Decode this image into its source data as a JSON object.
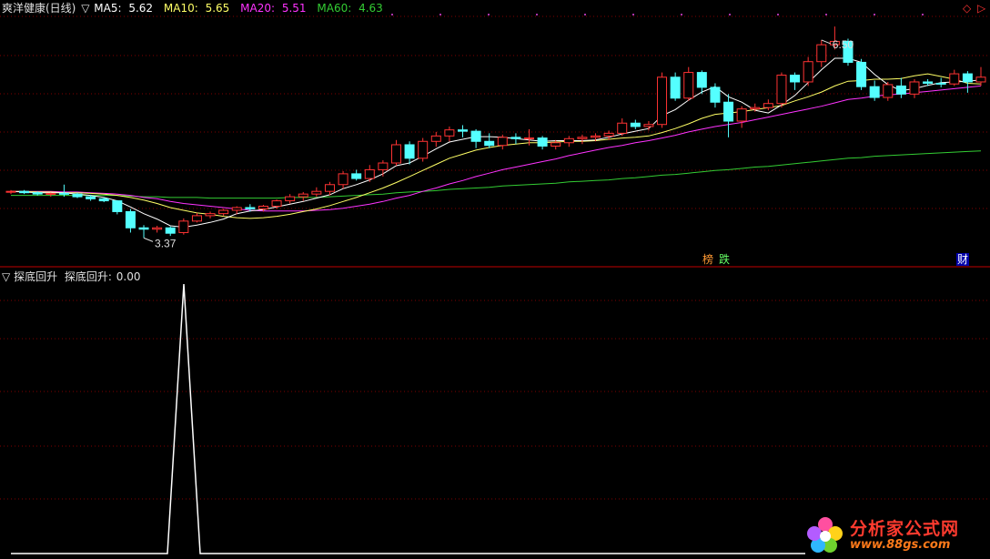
{
  "header": {
    "stock_title": "爽洋健康(日线)",
    "collapse_glyph": "▽",
    "ma5_label": "MA5:",
    "ma5_value": "5.62",
    "ma10_label": "MA10:",
    "ma10_value": "5.65",
    "ma20_label": "MA20:",
    "ma20_value": "5.51",
    "ma60_label": "MA60:",
    "ma60_value": "4.63"
  },
  "indicator": {
    "collapse_glyph": "▽",
    "name": "探底回升",
    "series_label": "探底回升:",
    "series_value": "0.00"
  },
  "markers": {
    "high_label": "6.50",
    "low_label": "3.37",
    "tag_bang": "榜",
    "tag_die": "跌",
    "tag_cai": "财"
  },
  "colors": {
    "bg": "#000000",
    "up": "#ff3333",
    "down": "#54ffff",
    "ma5": "#ffffff",
    "ma10": "#ffff66",
    "ma20": "#ff33ff",
    "ma60": "#33cc33",
    "grid": "#800000",
    "panel_border": "#c00000",
    "indicator_line": "#ffffff"
  },
  "icons": {
    "top_right_diamond": "diamond-icon",
    "top_right_arrow": "right-arrow-icon",
    "logo": "flower-logo-icon"
  },
  "logo": {
    "title": "分析家公式网",
    "url": "www.88gs.com"
  },
  "chart_data": {
    "type": "candlestick",
    "ylim": [
      3.2,
      6.65
    ],
    "candles": [
      [
        4.05,
        4.08,
        4.02,
        4.06
      ],
      [
        4.06,
        4.08,
        4.02,
        4.04
      ],
      [
        4.04,
        4.06,
        4.0,
        4.02
      ],
      [
        4.02,
        4.04,
        3.98,
        4.03
      ],
      [
        4.03,
        4.16,
        3.98,
        4.02
      ],
      [
        4.02,
        4.04,
        3.96,
        3.98
      ],
      [
        3.98,
        4.01,
        3.92,
        3.95
      ],
      [
        3.95,
        3.97,
        3.9,
        3.92
      ],
      [
        3.92,
        3.93,
        3.72,
        3.76
      ],
      [
        3.76,
        3.8,
        3.45,
        3.52
      ],
      [
        3.52,
        3.56,
        3.37,
        3.5
      ],
      [
        3.5,
        3.55,
        3.45,
        3.52
      ],
      [
        3.52,
        3.54,
        3.4,
        3.44
      ],
      [
        3.45,
        3.66,
        3.42,
        3.62
      ],
      [
        3.62,
        3.74,
        3.6,
        3.7
      ],
      [
        3.7,
        3.76,
        3.66,
        3.73
      ],
      [
        3.73,
        3.8,
        3.7,
        3.78
      ],
      [
        3.78,
        3.84,
        3.72,
        3.82
      ],
      [
        3.82,
        3.87,
        3.76,
        3.8
      ],
      [
        3.8,
        3.86,
        3.76,
        3.84
      ],
      [
        3.84,
        3.94,
        3.8,
        3.92
      ],
      [
        3.92,
        4.02,
        3.88,
        3.98
      ],
      [
        3.98,
        4.05,
        3.92,
        4.02
      ],
      [
        4.02,
        4.12,
        3.98,
        4.06
      ],
      [
        4.06,
        4.2,
        4.0,
        4.16
      ],
      [
        4.16,
        4.36,
        4.1,
        4.32
      ],
      [
        4.32,
        4.38,
        4.22,
        4.25
      ],
      [
        4.25,
        4.45,
        4.2,
        4.38
      ],
      [
        4.38,
        4.52,
        4.28,
        4.48
      ],
      [
        4.48,
        4.82,
        4.44,
        4.75
      ],
      [
        4.75,
        4.8,
        4.46,
        4.55
      ],
      [
        4.55,
        4.85,
        4.5,
        4.8
      ],
      [
        4.8,
        4.94,
        4.72,
        4.88
      ],
      [
        4.88,
        5.02,
        4.8,
        4.97
      ],
      [
        4.97,
        5.04,
        4.86,
        4.95
      ],
      [
        4.95,
        4.98,
        4.7,
        4.8
      ],
      [
        4.8,
        4.92,
        4.7,
        4.74
      ],
      [
        4.74,
        4.9,
        4.68,
        4.86
      ],
      [
        4.86,
        4.92,
        4.76,
        4.84
      ],
      [
        4.84,
        4.98,
        4.74,
        4.85
      ],
      [
        4.85,
        4.88,
        4.68,
        4.73
      ],
      [
        4.73,
        4.82,
        4.68,
        4.78
      ],
      [
        4.78,
        4.88,
        4.72,
        4.84
      ],
      [
        4.84,
        4.9,
        4.76,
        4.86
      ],
      [
        4.86,
        4.92,
        4.8,
        4.88
      ],
      [
        4.88,
        4.96,
        4.82,
        4.92
      ],
      [
        4.92,
        5.14,
        4.88,
        5.07
      ],
      [
        5.07,
        5.12,
        4.98,
        5.02
      ],
      [
        5.02,
        5.1,
        4.96,
        5.05
      ],
      [
        5.05,
        5.82,
        5.0,
        5.75
      ],
      [
        5.75,
        5.82,
        5.4,
        5.44
      ],
      [
        5.44,
        5.9,
        5.4,
        5.82
      ],
      [
        5.82,
        5.85,
        5.5,
        5.6
      ],
      [
        5.6,
        5.66,
        5.3,
        5.38
      ],
      [
        5.38,
        5.5,
        4.86,
        5.1
      ],
      [
        5.1,
        5.32,
        5.0,
        5.28
      ],
      [
        5.28,
        5.36,
        5.24,
        5.3
      ],
      [
        5.3,
        5.42,
        5.26,
        5.36
      ],
      [
        5.36,
        5.82,
        5.3,
        5.78
      ],
      [
        5.78,
        5.82,
        5.56,
        5.68
      ],
      [
        5.68,
        6.05,
        5.62,
        5.98
      ],
      [
        5.98,
        6.3,
        5.9,
        6.23
      ],
      [
        6.23,
        6.5,
        6.16,
        6.28
      ],
      [
        6.28,
        6.32,
        5.92,
        5.97
      ],
      [
        5.97,
        6.02,
        5.56,
        5.61
      ],
      [
        5.61,
        5.7,
        5.4,
        5.45
      ],
      [
        5.45,
        5.68,
        5.4,
        5.64
      ],
      [
        5.62,
        5.74,
        5.44,
        5.5
      ],
      [
        5.5,
        5.72,
        5.44,
        5.68
      ],
      [
        5.68,
        5.72,
        5.62,
        5.66
      ],
      [
        5.66,
        5.74,
        5.6,
        5.65
      ],
      [
        5.65,
        5.86,
        5.62,
        5.8
      ],
      [
        5.8,
        5.84,
        5.52,
        5.68
      ],
      [
        5.68,
        5.9,
        5.62,
        5.75
      ]
    ],
    "ma": {
      "ma5": [
        4.06,
        4.05,
        4.04,
        4.04,
        4.04,
        4.02,
        4.0,
        3.97,
        3.92,
        3.83,
        3.73,
        3.65,
        3.55,
        3.53,
        3.56,
        3.6,
        3.65,
        3.73,
        3.77,
        3.79,
        3.83,
        3.87,
        3.91,
        3.96,
        4.01,
        4.1,
        4.16,
        4.23,
        4.32,
        4.44,
        4.48,
        4.58,
        4.69,
        4.79,
        4.83,
        4.87,
        4.87,
        4.86,
        4.84,
        4.82,
        4.8,
        4.81,
        4.81,
        4.81,
        4.82,
        4.86,
        4.91,
        4.95,
        4.99,
        5.18,
        5.27,
        5.41,
        5.53,
        5.61,
        5.46,
        5.38,
        5.26,
        5.22,
        5.34,
        5.48,
        5.67,
        5.86,
        6.03,
        6.03,
        5.97,
        5.79,
        5.64,
        5.55,
        5.58,
        5.63,
        5.67,
        5.68,
        5.69,
        5.71
      ],
      "ma10": [
        4.06,
        4.06,
        4.05,
        4.05,
        4.04,
        4.04,
        4.03,
        4.02,
        4.0,
        3.97,
        3.93,
        3.88,
        3.82,
        3.78,
        3.74,
        3.72,
        3.69,
        3.67,
        3.66,
        3.67,
        3.69,
        3.72,
        3.76,
        3.8,
        3.85,
        3.91,
        3.97,
        4.04,
        4.11,
        4.19,
        4.28,
        4.37,
        4.46,
        4.55,
        4.61,
        4.67,
        4.71,
        4.74,
        4.76,
        4.78,
        4.78,
        4.79,
        4.8,
        4.8,
        4.81,
        4.83,
        4.85,
        4.86,
        4.88,
        4.93,
        4.99,
        5.06,
        5.14,
        5.2,
        5.22,
        5.24,
        5.27,
        5.3,
        5.33,
        5.4,
        5.46,
        5.53,
        5.62,
        5.69,
        5.7,
        5.72,
        5.72,
        5.73,
        5.77,
        5.8,
        5.76,
        5.72,
        5.66,
        5.65
      ],
      "ma20": [
        4.06,
        4.06,
        4.06,
        4.06,
        4.05,
        4.05,
        4.04,
        4.03,
        4.02,
        4.0,
        3.97,
        3.95,
        3.91,
        3.88,
        3.86,
        3.84,
        3.82,
        3.8,
        3.78,
        3.77,
        3.77,
        3.77,
        3.77,
        3.78,
        3.79,
        3.81,
        3.84,
        3.87,
        3.91,
        3.96,
        4.0,
        4.06,
        4.11,
        4.17,
        4.22,
        4.28,
        4.33,
        4.38,
        4.42,
        4.46,
        4.5,
        4.54,
        4.59,
        4.63,
        4.67,
        4.71,
        4.74,
        4.78,
        4.81,
        4.85,
        4.89,
        4.94,
        4.98,
        5.02,
        5.05,
        5.08,
        5.12,
        5.16,
        5.2,
        5.24,
        5.28,
        5.32,
        5.37,
        5.42,
        5.44,
        5.47,
        5.49,
        5.5,
        5.52,
        5.54,
        5.56,
        5.58,
        5.6,
        5.62
      ],
      "ma60": [
        4.0,
        4.0,
        4.0,
        4.0,
        4.0,
        4.0,
        4.0,
        4.0,
        4.0,
        3.99,
        3.98,
        3.98,
        3.97,
        3.97,
        3.97,
        3.96,
        3.96,
        3.96,
        3.96,
        3.96,
        3.96,
        3.97,
        3.97,
        3.97,
        3.98,
        3.99,
        4.0,
        4.01,
        4.02,
        4.04,
        4.05,
        4.06,
        4.07,
        4.09,
        4.1,
        4.11,
        4.12,
        4.14,
        4.15,
        4.16,
        4.17,
        4.18,
        4.2,
        4.21,
        4.22,
        4.23,
        4.25,
        4.26,
        4.28,
        4.3,
        4.31,
        4.33,
        4.35,
        4.37,
        4.38,
        4.4,
        4.42,
        4.43,
        4.45,
        4.47,
        4.49,
        4.51,
        4.53,
        4.55,
        4.56,
        4.58,
        4.59,
        4.6,
        4.61,
        4.62,
        4.63,
        4.64,
        4.65,
        4.66
      ]
    },
    "indicator_series": [
      0,
      0,
      0,
      0,
      0,
      0,
      0,
      0,
      0,
      0,
      1,
      0,
      0,
      0,
      0,
      0,
      0,
      0,
      0,
      0,
      0,
      0,
      0,
      0,
      0,
      0,
      0,
      0,
      0,
      0,
      0,
      0,
      0,
      0,
      0,
      0,
      0,
      0,
      0,
      0,
      0,
      0,
      0,
      0,
      0,
      0,
      0,
      0,
      0,
      0,
      0,
      0,
      0,
      0,
      0,
      0,
      0,
      0,
      0,
      0,
      0,
      0,
      0,
      0,
      0,
      0,
      0,
      0,
      0,
      0,
      0,
      0,
      0,
      0
    ],
    "high_marker_index": 61,
    "low_marker_index": 10
  }
}
